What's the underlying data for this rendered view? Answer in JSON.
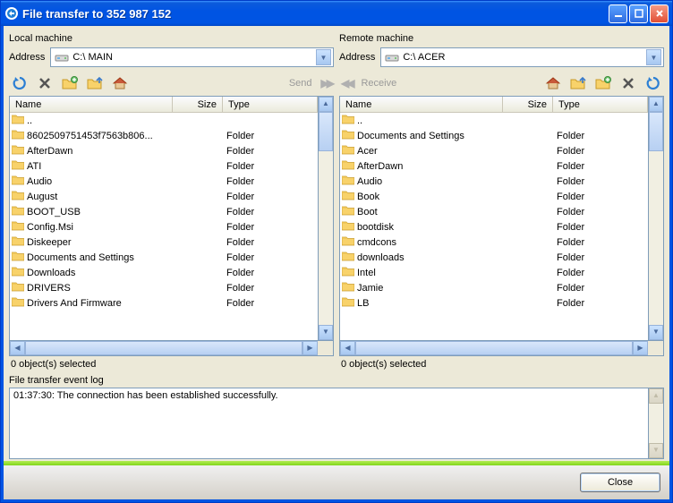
{
  "window": {
    "title": "File transfer to 352 987 152"
  },
  "left": {
    "title": "Local machine",
    "address_label": "Address",
    "address_value": "C:\\  MAIN",
    "columns": [
      "Name",
      "Size",
      "Type"
    ],
    "items": [
      {
        "name": "..",
        "size": "",
        "type": ""
      },
      {
        "name": "8602509751453f7563b806...",
        "size": "",
        "type": "Folder"
      },
      {
        "name": "AfterDawn",
        "size": "",
        "type": "Folder"
      },
      {
        "name": "ATI",
        "size": "",
        "type": "Folder"
      },
      {
        "name": "Audio",
        "size": "",
        "type": "Folder"
      },
      {
        "name": "August",
        "size": "",
        "type": "Folder"
      },
      {
        "name": "BOOT_USB",
        "size": "",
        "type": "Folder"
      },
      {
        "name": "Config.Msi",
        "size": "",
        "type": "Folder"
      },
      {
        "name": "Diskeeper",
        "size": "",
        "type": "Folder"
      },
      {
        "name": "Documents and Settings",
        "size": "",
        "type": "Folder"
      },
      {
        "name": "Downloads",
        "size": "",
        "type": "Folder"
      },
      {
        "name": "DRIVERS",
        "size": "",
        "type": "Folder"
      },
      {
        "name": "Drivers And Firmware",
        "size": "",
        "type": "Folder"
      }
    ],
    "status": "0 object(s) selected",
    "send_label": "Send"
  },
  "right": {
    "title": "Remote machine",
    "address_label": "Address",
    "address_value": "C:\\  ACER",
    "columns": [
      "Name",
      "Size",
      "Type"
    ],
    "items": [
      {
        "name": "..",
        "size": "",
        "type": ""
      },
      {
        "name": "Documents and Settings",
        "size": "",
        "type": "Folder"
      },
      {
        "name": "Acer",
        "size": "",
        "type": "Folder"
      },
      {
        "name": "AfterDawn",
        "size": "",
        "type": "Folder"
      },
      {
        "name": "Audio",
        "size": "",
        "type": "Folder"
      },
      {
        "name": "Book",
        "size": "",
        "type": "Folder"
      },
      {
        "name": "Boot",
        "size": "",
        "type": "Folder"
      },
      {
        "name": "bootdisk",
        "size": "",
        "type": "Folder"
      },
      {
        "name": "cmdcons",
        "size": "",
        "type": "Folder"
      },
      {
        "name": "downloads",
        "size": "",
        "type": "Folder"
      },
      {
        "name": "Intel",
        "size": "",
        "type": "Folder"
      },
      {
        "name": "Jamie",
        "size": "",
        "type": "Folder"
      },
      {
        "name": "LB",
        "size": "",
        "type": "Folder"
      }
    ],
    "status": "0 object(s) selected",
    "receive_label": "Receive"
  },
  "log": {
    "label": "File transfer event log",
    "entries": [
      "01:37:30: The connection has been established successfully."
    ]
  },
  "footer": {
    "close_label": "Close"
  }
}
